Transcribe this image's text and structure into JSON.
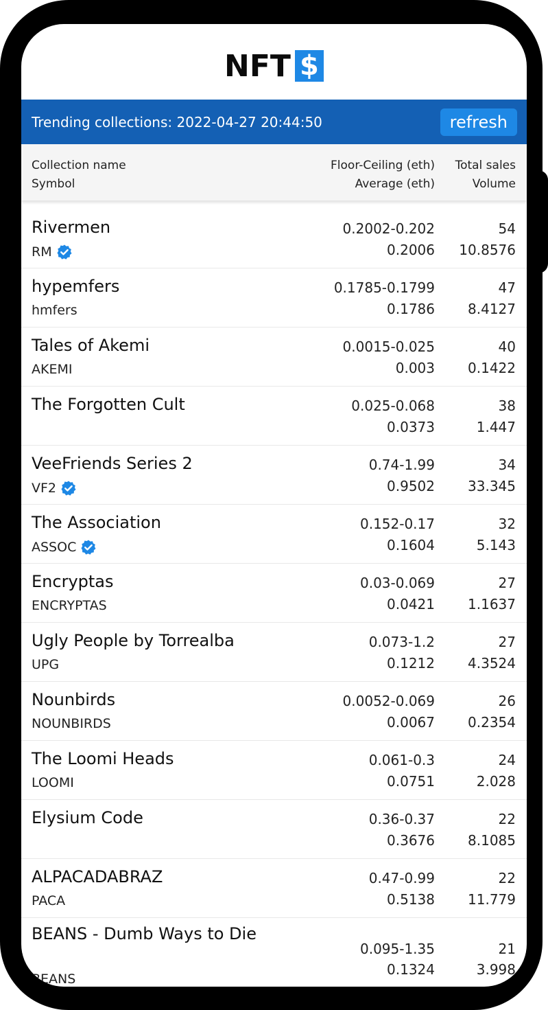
{
  "logo": {
    "text": "NFT",
    "mark": "$"
  },
  "header": {
    "title": "Trending collections: 2022-04-27 20:44:50",
    "refresh_label": "refresh"
  },
  "columns": {
    "name": "Collection name",
    "symbol": "Symbol",
    "floor_ceiling": "Floor-Ceiling (eth)",
    "average": "Average (eth)",
    "total_sales": "Total sales",
    "volume": "Volume"
  },
  "colors": {
    "brand_bar": "#1460b4",
    "accent": "#1e88e5",
    "verified": "#1e88e5"
  },
  "collections": [
    {
      "name": "Rivermen",
      "symbol": "RM",
      "verified": true,
      "floor_ceiling": "0.2002-0.202",
      "average": "0.2006",
      "total_sales": "54",
      "volume": "10.8576"
    },
    {
      "name": "hypemfers",
      "symbol": "hmfers",
      "verified": false,
      "floor_ceiling": "0.1785-0.1799",
      "average": "0.1786",
      "total_sales": "47",
      "volume": "8.4127"
    },
    {
      "name": "Tales of Akemi",
      "symbol": "AKEMI",
      "verified": false,
      "floor_ceiling": "0.0015-0.025",
      "average": "0.003",
      "total_sales": "40",
      "volume": "0.1422"
    },
    {
      "name": "The Forgotten Cult",
      "symbol": "",
      "verified": false,
      "floor_ceiling": "0.025-0.068",
      "average": "0.0373",
      "total_sales": "38",
      "volume": "1.447"
    },
    {
      "name": "VeeFriends Series 2",
      "symbol": "VF2",
      "verified": true,
      "floor_ceiling": "0.74-1.99",
      "average": "0.9502",
      "total_sales": "34",
      "volume": "33.345"
    },
    {
      "name": "The Association",
      "symbol": "ASSOC",
      "verified": true,
      "floor_ceiling": "0.152-0.17",
      "average": "0.1604",
      "total_sales": "32",
      "volume": "5.143"
    },
    {
      "name": "Encryptas",
      "symbol": "ENCRYPTAS",
      "verified": false,
      "floor_ceiling": "0.03-0.069",
      "average": "0.0421",
      "total_sales": "27",
      "volume": "1.1637"
    },
    {
      "name": "Ugly People by Torrealba",
      "symbol": "UPG",
      "verified": false,
      "floor_ceiling": "0.073-1.2",
      "average": "0.1212",
      "total_sales": "27",
      "volume": "4.3524"
    },
    {
      "name": "Nounbirds",
      "symbol": "NOUNBIRDS",
      "verified": false,
      "floor_ceiling": "0.0052-0.069",
      "average": "0.0067",
      "total_sales": "26",
      "volume": "0.2354"
    },
    {
      "name": "The Loomi Heads",
      "symbol": "LOOMI",
      "verified": false,
      "floor_ceiling": "0.061-0.3",
      "average": "0.0751",
      "total_sales": "24",
      "volume": "2.028"
    },
    {
      "name": "Elysium Code",
      "symbol": "",
      "verified": false,
      "floor_ceiling": "0.36-0.37",
      "average": "0.3676",
      "total_sales": "22",
      "volume": "8.1085"
    },
    {
      "name": "ALPACADABRAZ",
      "symbol": "PACA",
      "verified": false,
      "floor_ceiling": "0.47-0.99",
      "average": "0.5138",
      "total_sales": "22",
      "volume": "11.779"
    },
    {
      "name": "BEANS - Dumb Ways to Die",
      "symbol": "BEANS",
      "verified": false,
      "floor_ceiling": "0.095-1.35",
      "average": "0.1324",
      "total_sales": "21",
      "volume": "3.998"
    }
  ]
}
